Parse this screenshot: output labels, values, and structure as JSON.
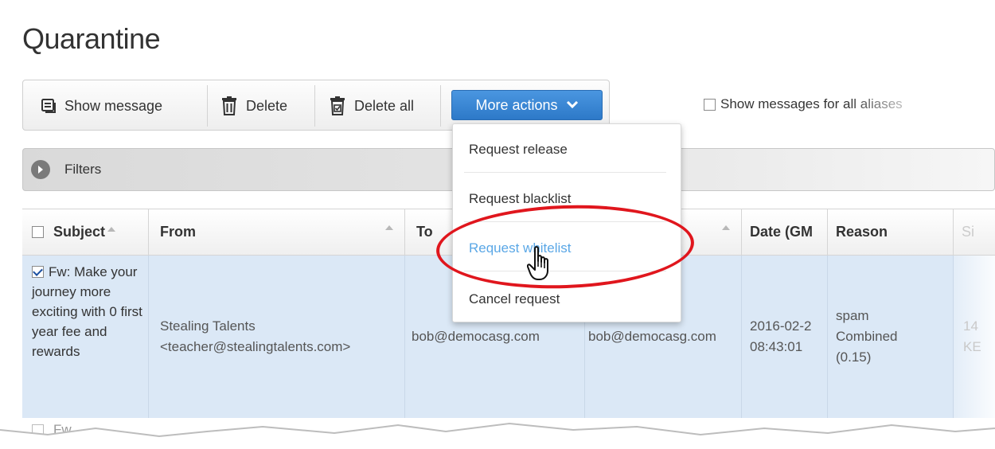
{
  "page": {
    "title": "Quarantine"
  },
  "toolbar": {
    "show_message": "Show message",
    "delete": "Delete",
    "delete_all": "Delete all",
    "more_actions": "More actions"
  },
  "aliases": {
    "label": "Show messages for all aliases",
    "checked": false
  },
  "filters": {
    "label": "Filters"
  },
  "table": {
    "headers": {
      "subject": "Subject",
      "from": "From",
      "to": "To",
      "date": "Date (GM",
      "reason": "Reason",
      "size": "Si"
    },
    "rows": [
      {
        "checked": true,
        "subject": "Fw: Make your journey more exciting with 0 first year fee and rewards",
        "from_name": "Stealing Talents",
        "from_email": "<teacher@stealingtalents.com>",
        "to": "bob@democasg.com",
        "recipient": "bob@democasg.com",
        "date": "2016-02-2",
        "time": "08:43:01",
        "reason_line1": "spam",
        "reason_line2": "Combined",
        "reason_line3": "(0.15)",
        "size_line1": "14",
        "size_line2": "KE"
      }
    ],
    "partial_row_text": "Fw"
  },
  "dropdown": {
    "items": [
      {
        "label": "Request release"
      },
      {
        "label": "Request blacklist"
      },
      {
        "label": "Request whitelist",
        "highlighted": true
      },
      {
        "label": "Cancel request"
      }
    ]
  },
  "colors": {
    "accent": "#2d79c8",
    "row_selected": "#dbe8f6",
    "highlight_link": "#5aa7e6",
    "annotation_red": "#e0161d"
  }
}
